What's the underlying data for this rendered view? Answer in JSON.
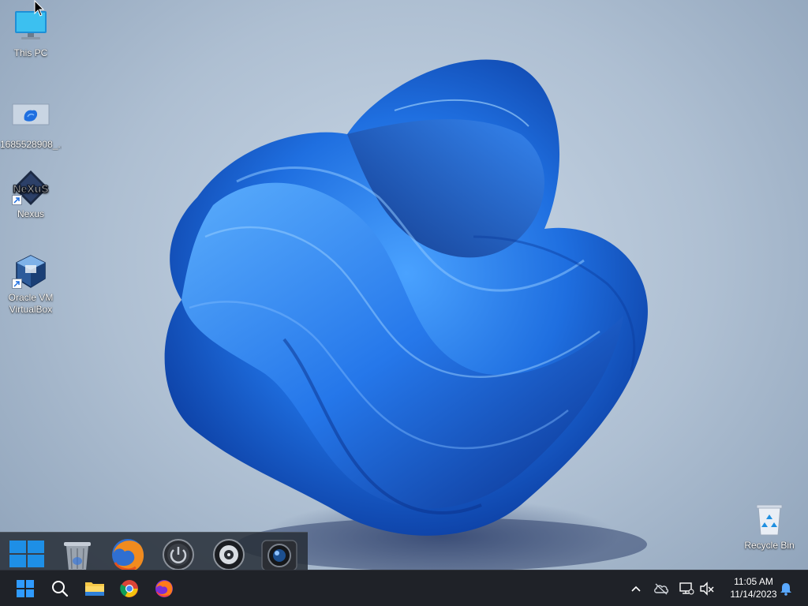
{
  "desktop": {
    "icons": [
      {
        "label": "This PC",
        "icon": "monitor-icon"
      },
      {
        "label": "1685528908_...",
        "icon": "image-file-icon"
      },
      {
        "label": "Nexus",
        "icon": "nexus-icon",
        "shortcut": true
      },
      {
        "label": "Oracle VM VirtualBox",
        "icon": "virtualbox-icon",
        "shortcut": true
      },
      {
        "label": "Recycle Bin",
        "icon": "recycle-bin-icon"
      }
    ],
    "nexus_logo_text": "NeXuS"
  },
  "dock": {
    "items": [
      {
        "name": "start",
        "icon": "windows-logo-icon"
      },
      {
        "name": "trash",
        "icon": "trash-can-icon"
      },
      {
        "name": "firefox",
        "icon": "firefox-icon"
      },
      {
        "name": "power",
        "icon": "power-icon"
      },
      {
        "name": "audio",
        "icon": "speaker-icon"
      },
      {
        "name": "camera",
        "icon": "camera-icon"
      }
    ]
  },
  "taskbar": {
    "buttons": [
      {
        "name": "start",
        "icon": "windows-logo-icon"
      },
      {
        "name": "search",
        "icon": "search-icon"
      },
      {
        "name": "file-explorer",
        "icon": "folder-icon"
      },
      {
        "name": "chrome",
        "icon": "chrome-icon"
      },
      {
        "name": "firefox",
        "icon": "firefox-icon"
      }
    ],
    "tray": {
      "icons": [
        "chevron-up-icon",
        "cloud-off-icon",
        "network-icon",
        "speaker-muted-icon",
        "notification-bell-icon"
      ],
      "time": "11:05 AM",
      "date": "11/14/2023"
    }
  },
  "colors": {
    "accent": "#1f6fe0",
    "taskbar_bg": "#1f2228",
    "bloom_dark": "#0b3fb8",
    "bloom_light": "#2f8cff"
  }
}
